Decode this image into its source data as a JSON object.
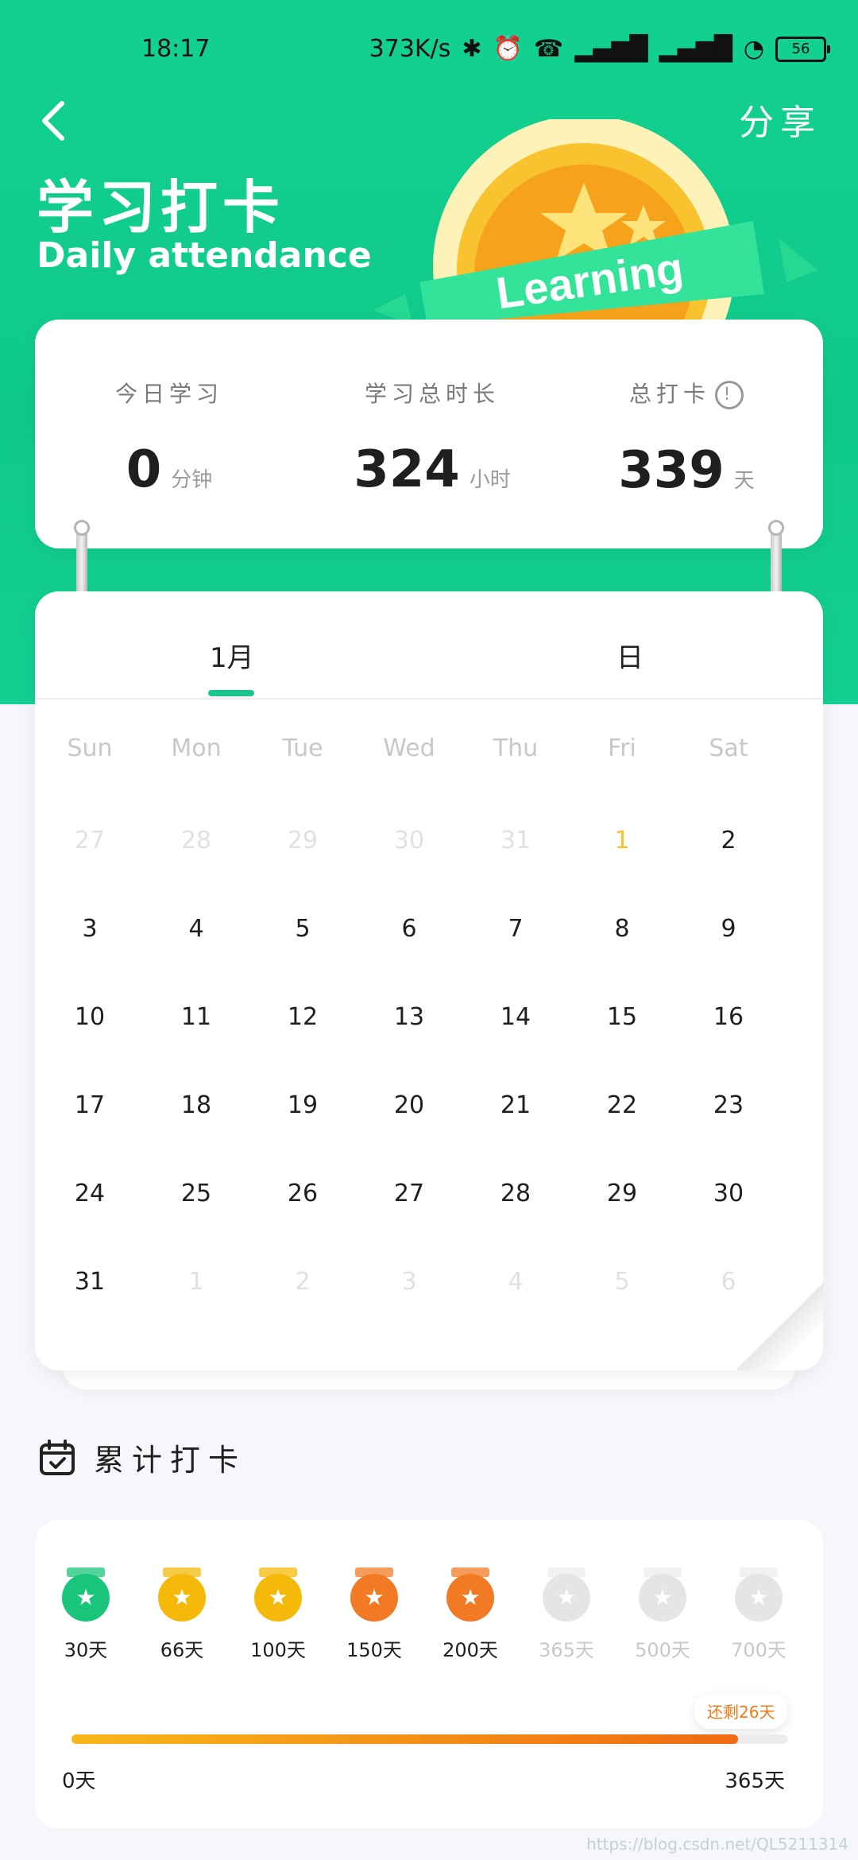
{
  "status": {
    "time": "18:17",
    "network": "373K/s",
    "battery": "56"
  },
  "header": {
    "share": "分享",
    "title_cn": "学习打卡",
    "title_en": "Daily attendance",
    "badge_text": "Learning"
  },
  "stats": [
    {
      "label": "今日学习",
      "value": "0",
      "unit": "分钟"
    },
    {
      "label": "学习总时长",
      "value": "324",
      "unit": "小时"
    },
    {
      "label": "总打卡",
      "value": "339",
      "unit": "天"
    }
  ],
  "calendar": {
    "tabs": [
      "1月",
      "日"
    ],
    "weekdays": [
      "Sun",
      "Mon",
      "Tue",
      "Wed",
      "Thu",
      "Fri",
      "Sat"
    ],
    "weeks": [
      [
        "27",
        "28",
        "29",
        "30",
        "31",
        "1",
        "2"
      ],
      [
        "3",
        "4",
        "5",
        "6",
        "7",
        "8",
        "9"
      ],
      [
        "10",
        "11",
        "12",
        "13",
        "14",
        "15",
        "16"
      ],
      [
        "17",
        "18",
        "19",
        "20",
        "21",
        "22",
        "23"
      ],
      [
        "24",
        "25",
        "26",
        "27",
        "28",
        "29",
        "30"
      ],
      [
        "31",
        "1",
        "2",
        "3",
        "4",
        "5",
        "6"
      ]
    ]
  },
  "accumulated": {
    "title": "累计打卡",
    "medals": [
      {
        "label": "30天",
        "color": "#19c57b",
        "locked": false
      },
      {
        "label": "66天",
        "color": "#f5b90a",
        "locked": false
      },
      {
        "label": "100天",
        "color": "#f5b90a",
        "locked": false
      },
      {
        "label": "150天",
        "color": "#f27a25",
        "locked": false
      },
      {
        "label": "200天",
        "color": "#f27a25",
        "locked": false
      },
      {
        "label": "365天",
        "color": "#e5e5e5",
        "locked": true
      },
      {
        "label": "500天",
        "color": "#e5e5e5",
        "locked": true
      },
      {
        "label": "700天",
        "color": "#e5e5e5",
        "locked": true
      }
    ],
    "remaining": "还剩26天",
    "progress": 0.93,
    "start": "0天",
    "end": "365天"
  },
  "watermark": "https://blog.csdn.net/QL5211314"
}
